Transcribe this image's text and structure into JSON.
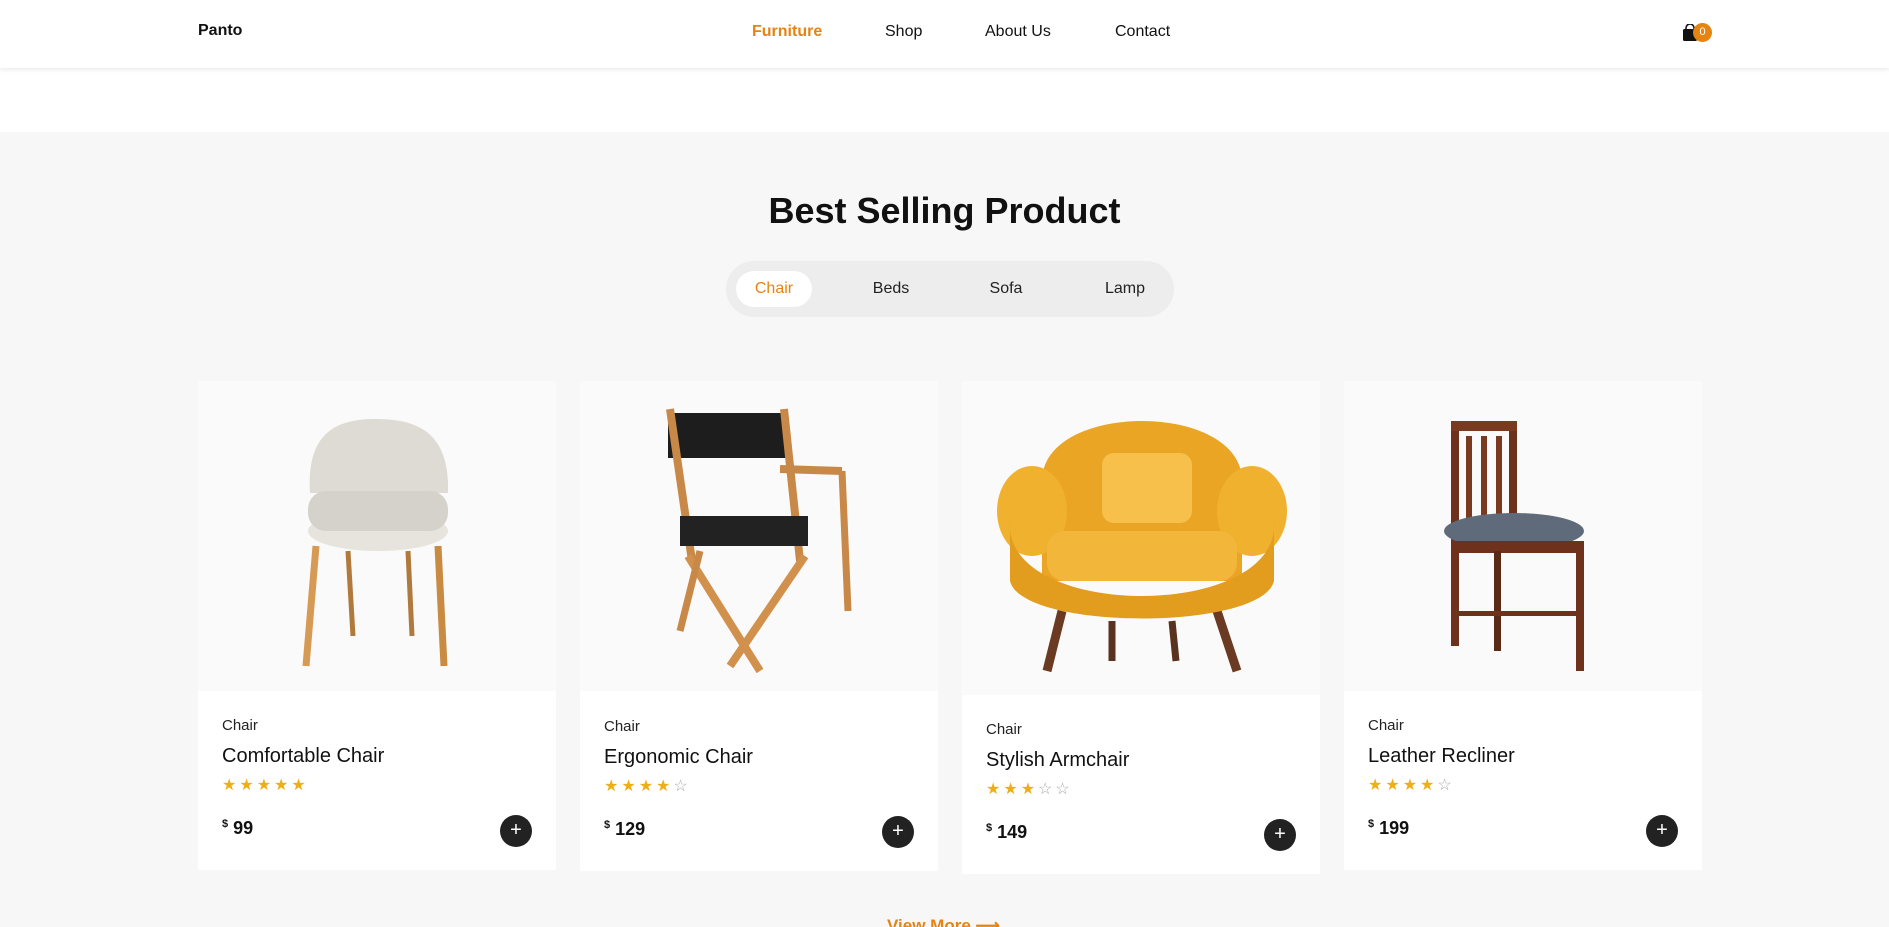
{
  "header": {
    "logo": "Panto",
    "nav": [
      {
        "label": "Furniture",
        "active": true
      },
      {
        "label": "Shop",
        "active": false
      },
      {
        "label": "About Us",
        "active": false
      },
      {
        "label": "Contact",
        "active": false
      }
    ],
    "cart_count": "0",
    "accent_color": "#e58411"
  },
  "section": {
    "title": "Best Selling Product",
    "tabs": [
      {
        "label": "Chair",
        "active": true
      },
      {
        "label": "Beds",
        "active": false
      },
      {
        "label": "Sofa",
        "active": false
      },
      {
        "label": "Lamp",
        "active": false
      }
    ]
  },
  "products": [
    {
      "category": "Chair",
      "name": "Comfortable Chair",
      "rating": 5,
      "currency": "$",
      "price": "99"
    },
    {
      "category": "Chair",
      "name": "Ergonomic Chair",
      "rating": 4,
      "currency": "$",
      "price": "129"
    },
    {
      "category": "Chair",
      "name": "Stylish Armchair",
      "rating": 3,
      "currency": "$",
      "price": "149"
    },
    {
      "category": "Chair",
      "name": "Leather Recliner",
      "rating": 4,
      "currency": "$",
      "price": "199"
    }
  ],
  "add_button_label": "+",
  "view_more": "View More"
}
